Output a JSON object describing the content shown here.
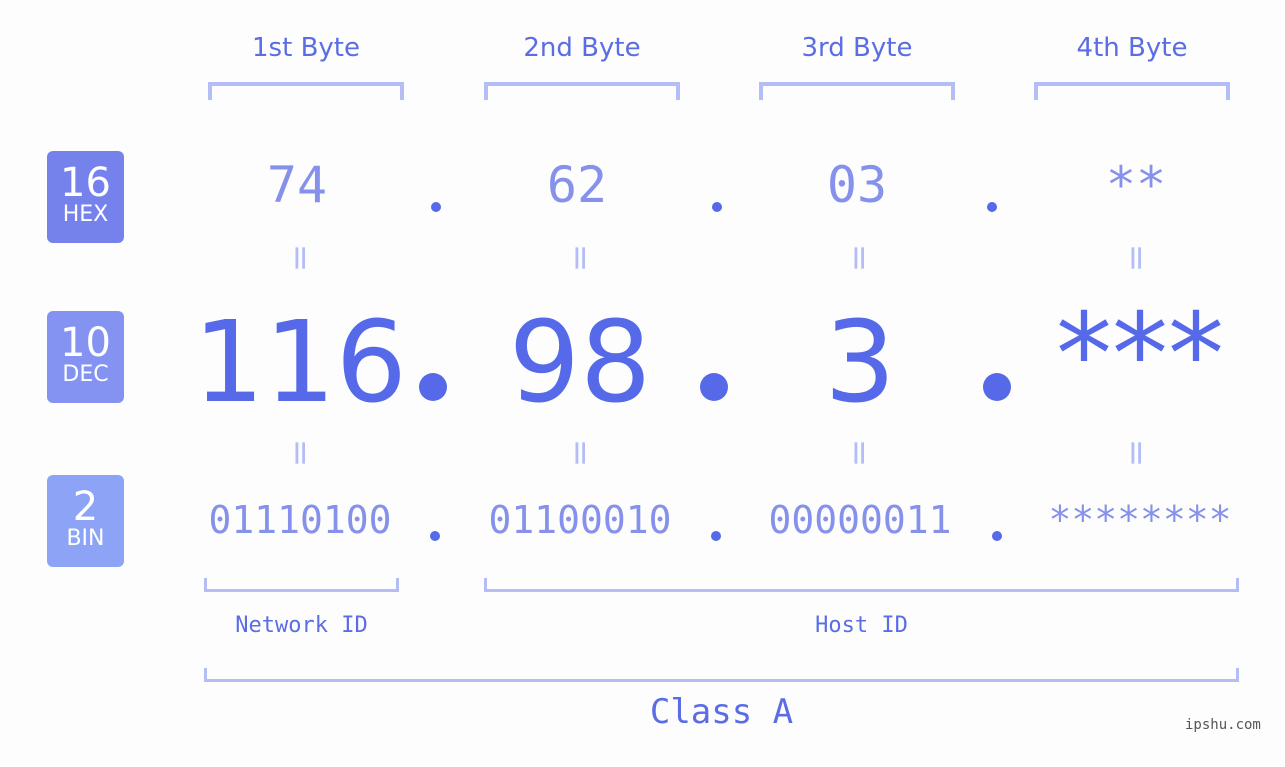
{
  "bytes": [
    {
      "label": "1st Byte",
      "hex": "74",
      "dec": "116",
      "bin": "01110100"
    },
    {
      "label": "2nd Byte",
      "hex": "62",
      "dec": "98",
      "bin": "01100010"
    },
    {
      "label": "3rd Byte",
      "hex": "03",
      "dec": "3",
      "bin": "00000011"
    },
    {
      "label": "4th Byte",
      "hex": "**",
      "dec": "***",
      "bin": "********"
    }
  ],
  "badges": {
    "hex": {
      "num": "16",
      "label": "HEX",
      "color": "#7582ec"
    },
    "dec": {
      "num": "10",
      "label": "DEC",
      "color": "#8493f2"
    },
    "bin": {
      "num": "2",
      "label": "BIN",
      "color": "#8da4f6"
    }
  },
  "equals_sign": "=",
  "network_id_label": "Network ID",
  "host_id_label": "Host ID",
  "class_label": "Class A",
  "watermark": "ipshu.com",
  "colors": {
    "accent": "#5569e9",
    "light_accent": "#8591ea",
    "bracket": "#b4bdf6",
    "text": "#5a6de4"
  }
}
